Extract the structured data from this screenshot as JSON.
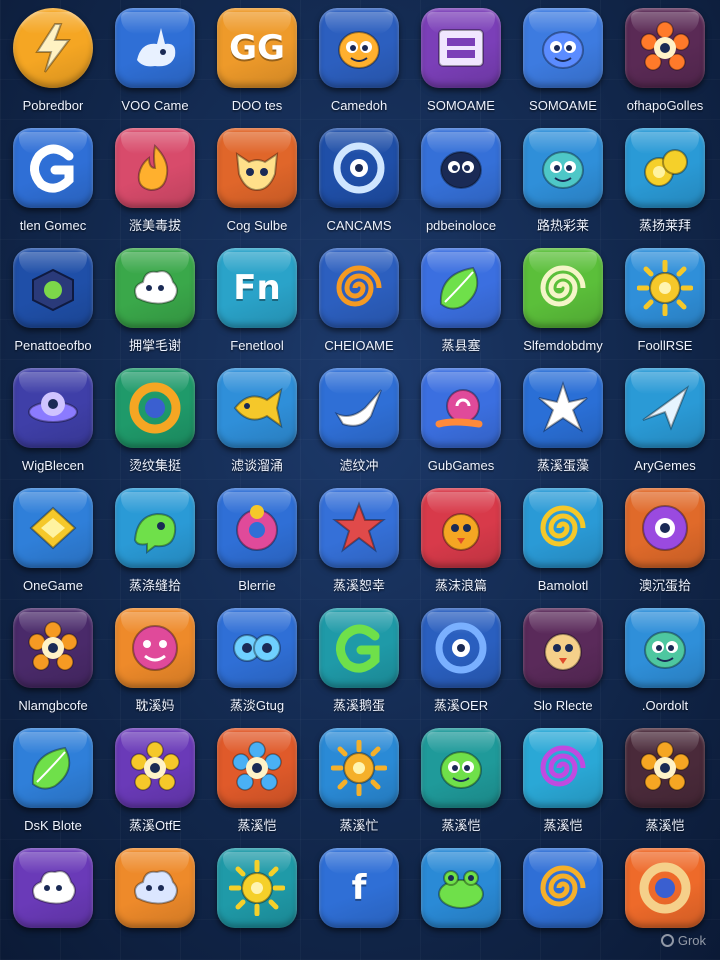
{
  "apps": [
    {
      "label": "Pobredbor",
      "icon": "lightning-icon",
      "color": "#f5a623",
      "accent": "#fff2c2",
      "shape": "round"
    },
    {
      "label": "VOO Came",
      "icon": "rabbit-icon",
      "color": "#2f6fd6",
      "accent": "#e8f1ff"
    },
    {
      "label": "DOO tes",
      "icon": "text-icon",
      "text": "GG",
      "color": "#ee9a2a",
      "accent": "#fff"
    },
    {
      "label": "Camedoh",
      "icon": "eye-creature-icon",
      "color": "#2c5fbf",
      "accent": "#ffb02e"
    },
    {
      "label": "SOMOAME",
      "icon": "window-icon",
      "color": "#7b3fb8",
      "accent": "#f0e6ff"
    },
    {
      "label": "SOMOAME",
      "icon": "creature-icon",
      "color": "#3d7be0",
      "accent": "#5b8cff"
    },
    {
      "label": "ofhapoGolles",
      "icon": "flower-icon",
      "color": "#5a2a55",
      "accent": "#ff7a2a"
    },
    {
      "label": "tlen Gomec",
      "icon": "swirl-g-icon",
      "color": "#2f6fd6",
      "accent": "#ffffff"
    },
    {
      "label": "涨美毒拔",
      "icon": "flame-icon",
      "color": "#d84b6b",
      "accent": "#ffb02e"
    },
    {
      "label": "Cog Sulbe",
      "icon": "cat-face-icon",
      "color": "#e0662a",
      "accent": "#ffe08a"
    },
    {
      "label": "CANCAMS",
      "icon": "eye-ring-icon",
      "color": "#1f4fa8",
      "accent": "#cfe6ff"
    },
    {
      "label": "pdbeinoloce",
      "icon": "creature-icon",
      "color": "#3570d8",
      "accent": "#1a2a55"
    },
    {
      "label": "路热彩莱",
      "icon": "creature-icon",
      "color": "#2f8fd9",
      "accent": "#4ec7c7"
    },
    {
      "label": "蒸扬莱拜",
      "icon": "coins-icon",
      "color": "#2a9ad6",
      "accent": "#f5d02a"
    },
    {
      "label": "Penattoeofbo",
      "icon": "box-icon",
      "color": "#1f4fa8",
      "accent": "#7cd84a"
    },
    {
      "label": "拥掌毛谢",
      "icon": "cloud-face-icon",
      "color": "#3aa84a",
      "accent": "#ffffff"
    },
    {
      "label": "Fenetlool",
      "icon": "text-icon",
      "text": "Fn",
      "color": "#2aa3c9",
      "accent": "#fff"
    },
    {
      "label": "CHEIOAME",
      "icon": "spiral-icon",
      "color": "#2c5fbf",
      "accent": "#f59a23"
    },
    {
      "label": "蒸县塞",
      "icon": "leaf-blob-icon",
      "color": "#3b6fe0",
      "accent": "#6fe04a"
    },
    {
      "label": "Slfemdobdmy",
      "icon": "spiral-icon",
      "color": "#5bbf3a",
      "accent": "#f5f5c8"
    },
    {
      "label": "FoollRSE",
      "icon": "sun-icon",
      "color": "#2f8fd9",
      "accent": "#f5c82a"
    },
    {
      "label": "WigBlecen",
      "icon": "ufo-icon",
      "color": "#3f3fa8",
      "accent": "#8b7bff"
    },
    {
      "label": "烫纹集挺",
      "icon": "ring-icon",
      "color": "#1f9a6a",
      "accent": "#f5a623"
    },
    {
      "label": "滤谈溜涌",
      "icon": "fish-icon",
      "color": "#2f8fd9",
      "accent": "#f5c82a"
    },
    {
      "label": "滤纹冲",
      "icon": "bird-icon",
      "color": "#2f6fd6",
      "accent": "#ffffff"
    },
    {
      "label": "GubGames",
      "icon": "snail-icon",
      "color": "#3b6fe0",
      "accent": "#ff8a3a"
    },
    {
      "label": "蒸溪蛋藻",
      "icon": "splash-icon",
      "color": "#2a6fd6",
      "accent": "#ffffff"
    },
    {
      "label": "AryGemes",
      "icon": "arrow-icon",
      "color": "#2a9ad6",
      "accent": "#e6f4ff"
    },
    {
      "label": "OneGame",
      "icon": "diamond-box-icon",
      "color": "#2f7fd9",
      "accent": "#f5c82a"
    },
    {
      "label": "蒸涤缝拾",
      "icon": "dragon-icon",
      "color": "#2a9ad6",
      "accent": "#6fe04a"
    },
    {
      "label": "Blerrie",
      "icon": "donut-icon",
      "color": "#2f6fd6",
      "accent": "#e04a9a"
    },
    {
      "label": "蒸溪恕幸",
      "icon": "star-icon",
      "color": "#3570d8",
      "accent": "#e04a4a"
    },
    {
      "label": "蒸沫浪篇",
      "icon": "chick-icon",
      "color": "#d83a4a",
      "accent": "#f5a623"
    },
    {
      "label": "Bamolotl",
      "icon": "spiral-icon",
      "color": "#2a9ad6",
      "accent": "#f5c82a"
    },
    {
      "label": "澳沉蛋拾",
      "icon": "orb-icon",
      "color": "#e06a2a",
      "accent": "#9a4ae0"
    },
    {
      "label": "Nlamgbcofe",
      "icon": "gear-icon",
      "color": "#4a2a6a",
      "accent": "#f59a23"
    },
    {
      "label": "耽溪妈",
      "icon": "face-icon",
      "color": "#ee8a2a",
      "accent": "#e04a9a"
    },
    {
      "label": "蒸淡Gtug",
      "icon": "eyes-icon",
      "color": "#2f6fd6",
      "accent": "#6fd0ff"
    },
    {
      "label": "蒸溪鹅蛋",
      "icon": "swirl-g-icon",
      "color": "#1f9aa8",
      "accent": "#6fe04a"
    },
    {
      "label": "蒸溪OER",
      "icon": "eye-ring-icon",
      "color": "#2a5fbf",
      "accent": "#7ab0ff"
    },
    {
      "label": "Slo Rlecte",
      "icon": "chick-icon",
      "color": "#5a2a5a",
      "accent": "#f5d08a"
    },
    {
      "label": ".Oordolt",
      "icon": "creature-icon",
      "color": "#2f8fd9",
      "accent": "#4ec7a0"
    },
    {
      "label": "DsK Blote",
      "icon": "leaf-icon",
      "color": "#2f7fd9",
      "accent": "#6fe04a"
    },
    {
      "label": "蒸溪OtfE",
      "icon": "gear-icon",
      "color": "#6a3ab8",
      "accent": "#f5c82a"
    },
    {
      "label": "蒸溪恺",
      "icon": "gear-icon",
      "color": "#e05a2a",
      "accent": "#4ab0f5"
    },
    {
      "label": "蒸溪忙",
      "icon": "sun-icon",
      "color": "#2a8ad6",
      "accent": "#f5b02a"
    },
    {
      "label": "蒸溪恺",
      "icon": "creature-icon",
      "color": "#1f9a9a",
      "accent": "#6fe04a"
    },
    {
      "label": "蒸溪恺",
      "icon": "swirl-icon",
      "color": "#2aa8d6",
      "accent": "#c04ae0"
    },
    {
      "label": "蒸溪恺",
      "icon": "flower-icon",
      "color": "#4a2a3a",
      "accent": "#f5a623"
    },
    {
      "label": "",
      "icon": "cloud-face-icon",
      "color": "#6a3ab8",
      "accent": "#ffffff"
    },
    {
      "label": "",
      "icon": "cloud-face-icon",
      "color": "#ee8a2a",
      "accent": "#dbe6ff"
    },
    {
      "label": "",
      "icon": "sun-icon",
      "color": "#1f9aa8",
      "accent": "#f5d02a"
    },
    {
      "label": "",
      "icon": "text-icon",
      "text": "f",
      "color": "#2f6fd6",
      "accent": "#fff"
    },
    {
      "label": "",
      "icon": "frog-icon",
      "color": "#2a8ad6",
      "accent": "#6fe04a"
    },
    {
      "label": "",
      "icon": "spiral-icon",
      "color": "#2f6fd6",
      "accent": "#f5b02a"
    },
    {
      "label": "",
      "icon": "ring-icon",
      "color": "#ee6a2a",
      "accent": "#f5d08a"
    }
  ],
  "watermark": "Grok"
}
